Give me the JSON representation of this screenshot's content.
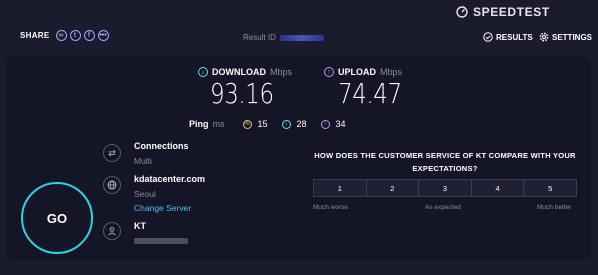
{
  "header": {
    "brand": "SPEEDTEST",
    "share_label": "SHARE",
    "share_icons": [
      "link-icon",
      "twitter-icon",
      "facebook-icon",
      "more-icon"
    ],
    "result_label": "Result ID",
    "nav": {
      "results": "RESULTS",
      "settings": "SETTINGS"
    }
  },
  "metrics": {
    "download": {
      "label": "DOWNLOAD",
      "unit": "Mbps",
      "value": "93.16",
      "color": "#6ee0f1"
    },
    "upload": {
      "label": "UPLOAD",
      "unit": "Mbps",
      "value": "74.47",
      "color": "#b89af5"
    }
  },
  "ping": {
    "label": "Ping",
    "unit": "ms",
    "idle": {
      "value": "15",
      "color": "#e9c46a"
    },
    "download": {
      "value": "28",
      "color": "#6ee0f1"
    },
    "upload": {
      "value": "34",
      "color": "#b89af5"
    }
  },
  "go_label": "GO",
  "connections": {
    "title": "Connections",
    "value": "Multi"
  },
  "server": {
    "host": "kdatacenter.com",
    "location": "Seoul",
    "change_label": "Change Server"
  },
  "provider": {
    "name": "KT"
  },
  "survey": {
    "question": "HOW DOES THE CUSTOMER SERVICE OF KT COMPARE WITH YOUR EXPECTATIONS?",
    "options": [
      "1",
      "2",
      "3",
      "4",
      "5"
    ],
    "low_label": "Much worse",
    "mid_label": "As expected",
    "high_label": "Much better"
  },
  "colors": {
    "background": "#1b1b2e",
    "panel": "#141526",
    "go_ring": "#2bd3dd",
    "link": "#47c0f4"
  }
}
